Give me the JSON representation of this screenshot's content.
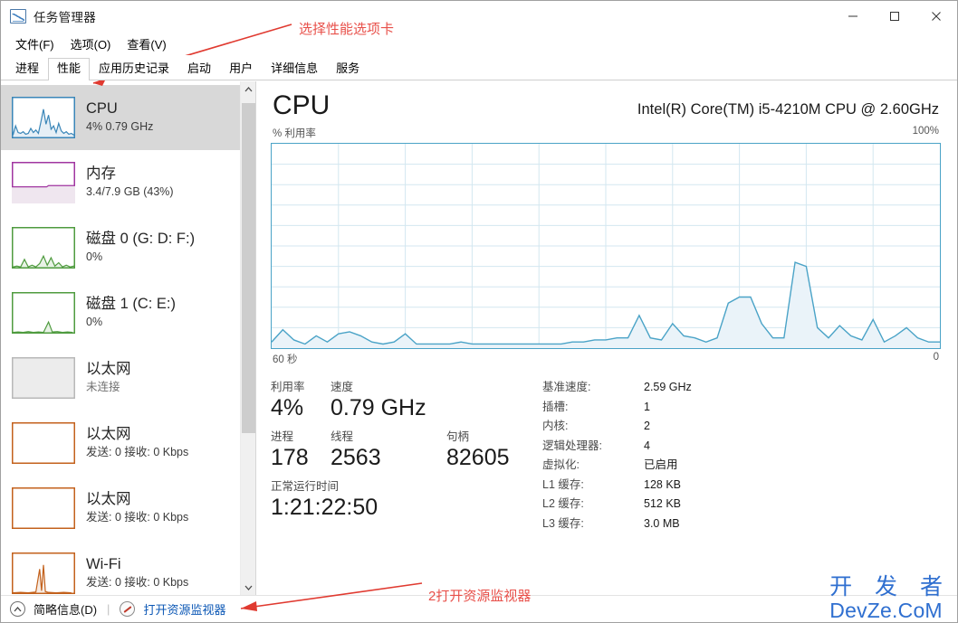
{
  "window": {
    "title": "任务管理器",
    "icon": "task-manager-icon",
    "minimize": "—",
    "maximize": "□",
    "close": "✕"
  },
  "menu": {
    "items": [
      {
        "label": "文件(F)"
      },
      {
        "label": "选项(O)"
      },
      {
        "label": "查看(V)"
      }
    ]
  },
  "tabs": {
    "active_index": 1,
    "items": [
      {
        "label": "进程"
      },
      {
        "label": "性能"
      },
      {
        "label": "应用历史记录"
      },
      {
        "label": "启动"
      },
      {
        "label": "用户"
      },
      {
        "label": "详细信息"
      },
      {
        "label": "服务"
      }
    ]
  },
  "sidebar": {
    "items": [
      {
        "title": "CPU",
        "sub": "4% 0.79 GHz",
        "color": "#3a86b8",
        "selected": true,
        "dim": false
      },
      {
        "title": "内存",
        "sub": "3.4/7.9 GB (43%)",
        "color": "#a035a0",
        "selected": false,
        "dim": false
      },
      {
        "title": "磁盘 0 (G: D: F:)",
        "sub": "0%",
        "color": "#4f9b3f",
        "selected": false,
        "dim": false
      },
      {
        "title": "磁盘 1 (C: E:)",
        "sub": "0%",
        "color": "#4f9b3f",
        "selected": false,
        "dim": false
      },
      {
        "title": "以太网",
        "sub": "未连接",
        "color": "#b8b8b8",
        "selected": false,
        "dim": true
      },
      {
        "title": "以太网",
        "sub": "发送: 0 接收: 0 Kbps",
        "color": "#c3611c",
        "selected": false,
        "dim": false
      },
      {
        "title": "以太网",
        "sub": "发送: 0 接收: 0 Kbps",
        "color": "#c3611c",
        "selected": false,
        "dim": false
      },
      {
        "title": "Wi-Fi",
        "sub": "发送: 0 接收: 0 Kbps",
        "color": "#c3611c",
        "selected": false,
        "dim": false
      }
    ]
  },
  "main": {
    "heading": "CPU",
    "model": "Intel(R) Core(TM) i5-4210M CPU @ 2.60GHz",
    "graph_top_left_label": "% 利用率",
    "graph_top_right_label": "100%",
    "graph_bottom_left_label": "60 秒",
    "graph_bottom_right_label": "0",
    "stats": {
      "utilization_label": "利用率",
      "utilization_value": "4%",
      "speed_label": "速度",
      "speed_value": "0.79 GHz",
      "processes_label": "进程",
      "processes_value": "178",
      "threads_label": "线程",
      "threads_value": "2563",
      "handles_label": "句柄",
      "handles_value": "82605",
      "uptime_label": "正常运行时间",
      "uptime_value": "1:21:22:50"
    },
    "specs": [
      {
        "key": "基准速度:",
        "value": "2.59 GHz"
      },
      {
        "key": "插槽:",
        "value": "1"
      },
      {
        "key": "内核:",
        "value": "2"
      },
      {
        "key": "逻辑处理器:",
        "value": "4"
      },
      {
        "key": "虚拟化:",
        "value": "已启用"
      },
      {
        "key": "L1 缓存:",
        "value": "128 KB"
      },
      {
        "key": "L2 缓存:",
        "value": "512 KB"
      },
      {
        "key": "L3 缓存:",
        "value": "3.0 MB"
      }
    ]
  },
  "statusbar": {
    "fewer_details": "简略信息(D)",
    "fewer_details_icon": "chevron-up-icon",
    "separator": "|",
    "resource_monitor": "打开资源监视器",
    "resource_monitor_icon": "resource-monitor-icon"
  },
  "annotations": [
    {
      "text": "选择性能选项卡",
      "color": "#e8504a"
    },
    {
      "text": "2打开资源监视器",
      "color": "#e8504a"
    }
  ],
  "watermark": {
    "line1": "开 发 者",
    "line2": "DevZe.CoM",
    "color": "#2f6fd0"
  },
  "chart_data": {
    "type": "area",
    "title": "CPU % 利用率",
    "xlabel": "",
    "ylabel": "% 利用率",
    "ylim": [
      0,
      100
    ],
    "xlim": [
      60,
      0
    ],
    "x_tick_labels": [
      "60 秒",
      "0"
    ],
    "y_tick_labels": [
      "100%",
      ""
    ],
    "grid": true,
    "grid_columns": 10,
    "grid_rows": 10,
    "line_color": "#4aa3c7",
    "fill_color": "#eaf3f9",
    "series": [
      {
        "name": "CPU 利用率",
        "values": [
          3,
          9,
          4,
          2,
          6,
          3,
          7,
          8,
          6,
          3,
          2,
          3,
          7,
          2,
          2,
          2,
          2,
          3,
          2,
          2,
          2,
          2,
          2,
          2,
          2,
          2,
          2,
          3,
          3,
          4,
          4,
          5,
          5,
          16,
          5,
          4,
          12,
          6,
          5,
          3,
          5,
          22,
          25,
          25,
          12,
          5,
          5,
          42,
          40,
          10,
          5,
          11,
          6,
          4,
          14,
          3,
          6,
          10,
          5,
          3,
          3
        ]
      }
    ]
  }
}
